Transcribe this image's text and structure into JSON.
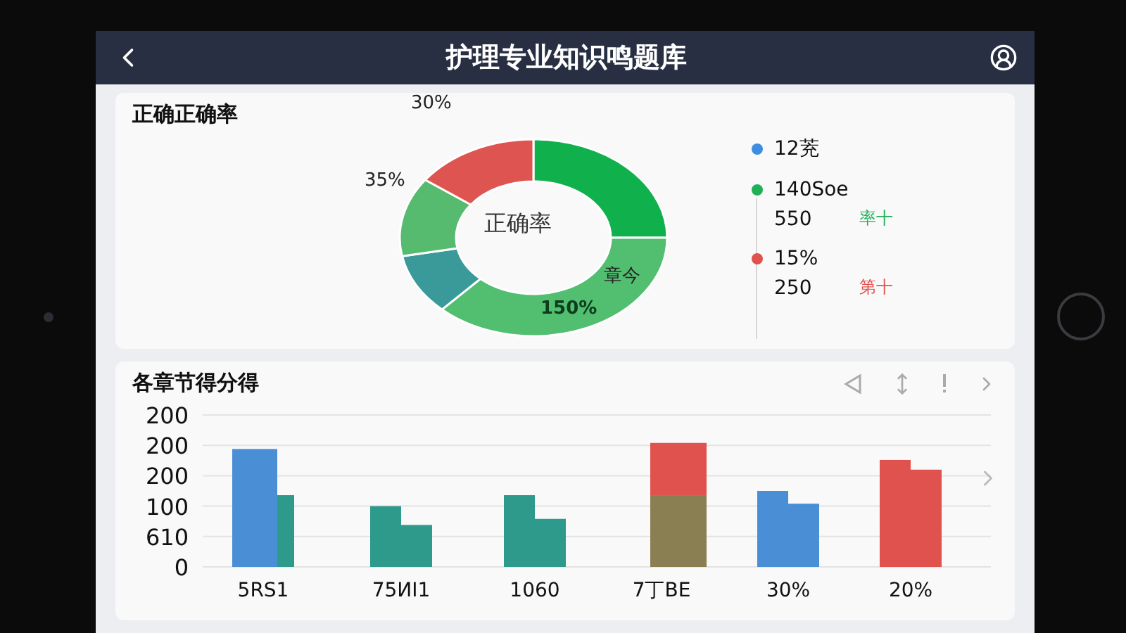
{
  "header": {
    "title": "护理专业知识鸣题库"
  },
  "accuracy_card": {
    "title": "正确正确率",
    "donut_center": "正确率",
    "donut_labels": [
      {
        "text": "30%",
        "kind": "outside"
      },
      {
        "text": "35%",
        "kind": "outside"
      },
      {
        "text": "150%",
        "kind": "inside"
      },
      {
        "text": "章今",
        "kind": "outside"
      }
    ],
    "legend": [
      {
        "label": "12茺",
        "color": "#3d8ee0"
      },
      {
        "label": "140Soe",
        "value": "550",
        "note": "率十",
        "color": "#1fb157"
      },
      {
        "label": "15%",
        "value": "250",
        "note": "第十",
        "color": "#e0524e"
      }
    ]
  },
  "score_card": {
    "title": "各章节得分得",
    "y_axis_labels": [
      "200",
      "200",
      "200",
      "100",
      "610",
      "0"
    ],
    "x_axis_labels": [
      "5RS1",
      "75ИI1",
      "1060",
      "7丁BE",
      "30%",
      "20%"
    ]
  }
}
